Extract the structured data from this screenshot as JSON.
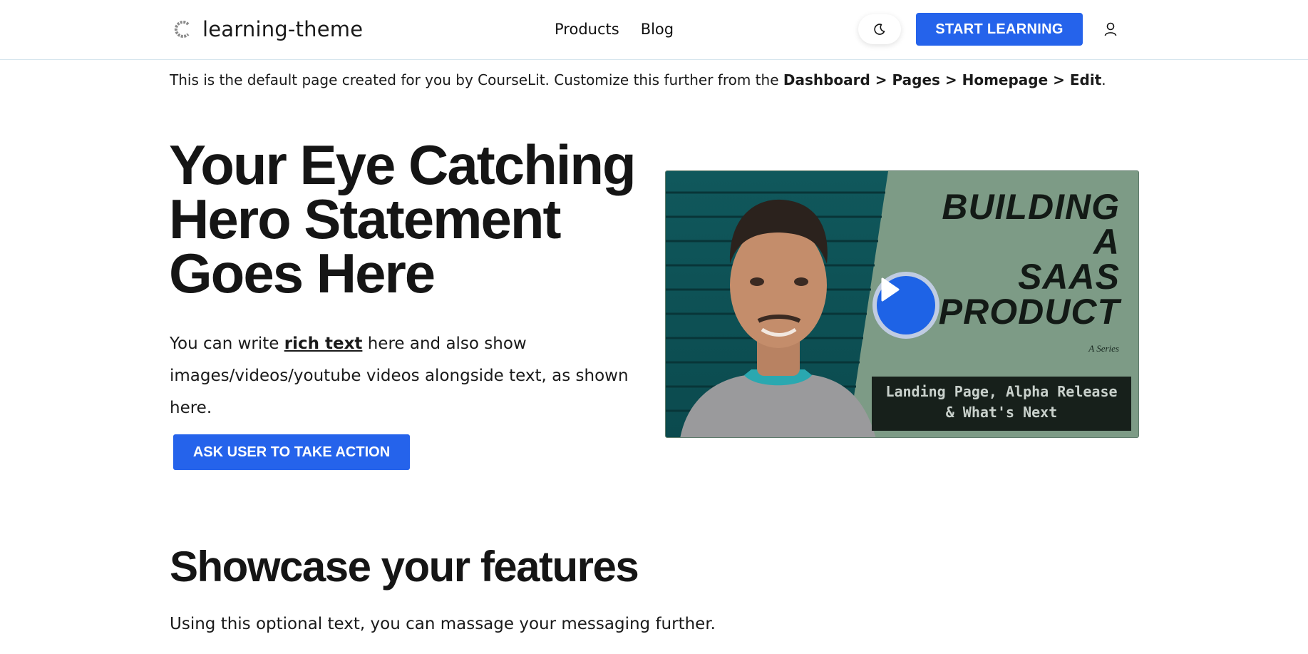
{
  "header": {
    "site_name": "learning-theme",
    "nav": [
      {
        "label": "Products"
      },
      {
        "label": "Blog"
      }
    ],
    "theme_toggle_icon": "moon-icon",
    "cta_label": "START LEARNING",
    "user_icon": "user-icon"
  },
  "notice": {
    "prefix": "This is the default page created for you by CourseLit. Customize this further from the ",
    "path": "Dashboard > Pages > Homepage > Edit",
    "suffix": "."
  },
  "hero": {
    "title_lines": [
      "Your Eye Catching",
      "Hero Statement",
      "Goes Here"
    ],
    "desc_pre": "You can write ",
    "desc_link": "rich text",
    "desc_post": " here and also show images/videos/youtube videos alongside text, as shown here.",
    "button_label": "ASK USER TO TAKE ACTION"
  },
  "video": {
    "title_lines": [
      "BUILDING",
      "A",
      "SAAS",
      "PRODUCT"
    ],
    "series_label": "A Series",
    "subtitle_lines": [
      "Landing Page, Alpha Release",
      "& What's Next"
    ],
    "play_icon": "play-icon"
  },
  "features": {
    "title": "Showcase your features",
    "desc": "Using this optional text, you can massage your messaging further."
  },
  "colors": {
    "primary": "#2563eb",
    "text": "#111111",
    "header_border": "#d6e6ee",
    "video_bg": "#7d9b86"
  }
}
